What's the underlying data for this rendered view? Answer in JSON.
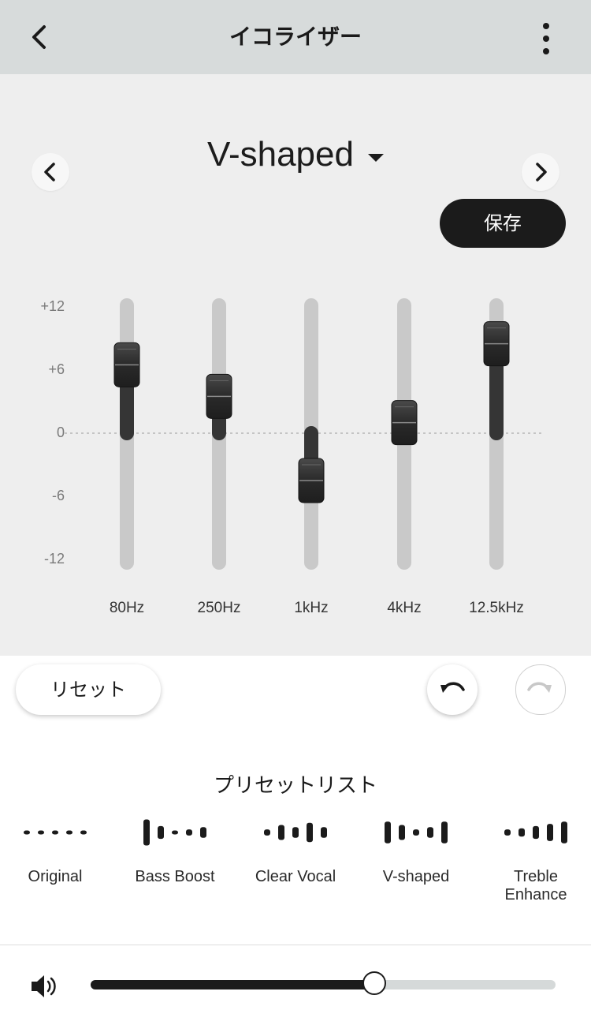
{
  "header": {
    "title": "イコライザー"
  },
  "preset": {
    "name": "V-shaped",
    "save_label": "保存"
  },
  "equalizer": {
    "scale_labels": [
      "+12",
      "+6",
      "0",
      "-6",
      "-12"
    ],
    "range": [
      -12,
      12
    ],
    "bands": [
      {
        "label": "80Hz",
        "gain": 6.5
      },
      {
        "label": "250Hz",
        "gain": 3.5
      },
      {
        "label": "1kHz",
        "gain": -4.5
      },
      {
        "label": "4kHz",
        "gain": 1.0
      },
      {
        "label": "12.5kHz",
        "gain": 8.5
      }
    ]
  },
  "controls": {
    "reset_label": "リセット"
  },
  "preset_list": {
    "title": "プリセットリスト",
    "items": [
      {
        "label": "Original",
        "bars": [
          0,
          0,
          0,
          0,
          0
        ]
      },
      {
        "label": "Bass Boost",
        "bars": [
          10,
          4,
          0,
          1,
          3
        ]
      },
      {
        "label": "Clear Vocal",
        "bars": [
          1,
          5,
          3,
          7,
          3
        ]
      },
      {
        "label": "V-shaped",
        "bars": [
          8,
          5,
          1,
          3,
          8
        ]
      },
      {
        "label": "Treble\nEnhance",
        "bars": [
          1,
          2,
          4,
          6,
          8
        ]
      }
    ]
  },
  "volume": {
    "level": 0.61
  },
  "colors": {
    "header_bg": "#d7dbdb",
    "eq_bg": "#eeeeee",
    "accent_dark": "#1b1b1b",
    "track": "#c9c9c9"
  }
}
